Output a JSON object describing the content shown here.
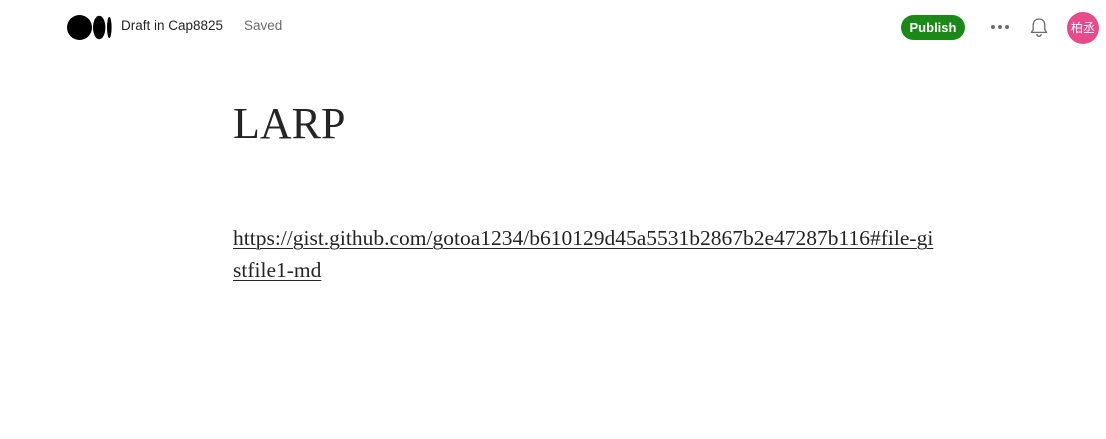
{
  "header": {
    "logo_icon": "medium-logo-icon",
    "draft_label": "Draft in Cap8825",
    "status": "Saved",
    "publish_label": "Publish",
    "more_icon": "more-horizontal-icon",
    "bell_icon": "bell-icon",
    "avatar_text": "柏丞",
    "colors": {
      "publish_bg": "#1a8917",
      "avatar_bg": "#e84b8a",
      "muted_text": "#6b6b6b"
    }
  },
  "story": {
    "title": "LARP",
    "link_text": "https://gist.github.com/gotoa1234/b610129d45a5531b2867b2e47287b116#file-gistfile1-md",
    "link_href": "https://gist.github.com/gotoa1234/b610129d45a5531b2867b2e47287b116#file-gistfile1-md"
  }
}
